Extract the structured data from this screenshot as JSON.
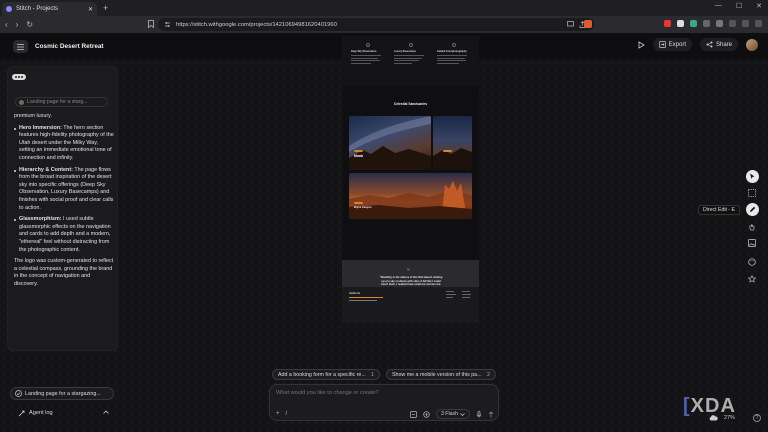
{
  "browser": {
    "tab_title": "Stitch - Projects",
    "url": "https://stitch.withgoogle.com/projects/14210694981620401960"
  },
  "header": {
    "project_title": "Cosmic Desert Retreat",
    "export_label": "Export",
    "share_label": "Share"
  },
  "chat": {
    "ref_tag": "Landing page for a starg...",
    "lead_text": "premium luxury.",
    "bullets": [
      {
        "title": "Hero Immersion:",
        "text": " The hero section features high-fidelity photography of the Utah desert under the Milky Way, setting an immediate emotional tone of connection and infinity."
      },
      {
        "title": "Hierarchy & Content:",
        "text": " The page flows from the broad inspiration of the desert sky into specific offerings (Deep Sky Observation, Luxury Basecamps) and finishes with social proof and clear calls to action."
      },
      {
        "title": "Glassmorphism:",
        "text": " I used subtle glassmorphic effects on the navigation and cards to add depth and a modern, \"ethereal\" feel without distracting from the photographic content."
      }
    ],
    "closing": "The logo was custom-generated to reflect a celestial compass, grounding the brand in the concept of navigation and discovery.",
    "context_chip": "Landing page for a stargazing...",
    "agent_log_label": "Agent log"
  },
  "preview": {
    "features": [
      {
        "title": "Deep Sky Observation"
      },
      {
        "title": "Luxury Basecamps"
      },
      {
        "title": "Guided Astrophotography"
      }
    ],
    "section_title": "Celestial Sanctuaries",
    "cards": [
      {
        "label": "Moab"
      },
      {
        "label": "Bryce Canyon"
      }
    ],
    "quote": "\"Standing in the silence of the Utah desert, looking up at a sky so dense with stars it felt like I could touch them, I realized how small our worries are. Aetheris didn't just show me the stars; they helped me find my place among them.\"",
    "footer_logo": "Aetheris"
  },
  "tools": {
    "tooltip": "Direct Edit - E"
  },
  "suggestions": [
    {
      "label": "Add a booking form for a specific re...",
      "num": "1"
    },
    {
      "label": "Show me a mobile version of this pa...",
      "num": "2"
    }
  ],
  "composer": {
    "placeholder": "What would you like to change or create?",
    "model": "3 Flash"
  },
  "status": {
    "zoom": "27%",
    "watermark": "XDA"
  },
  "colors": {
    "accent_orange": "#d9822b",
    "panel_bg": "#1b1b1e",
    "canvas_bg": "#141416"
  }
}
